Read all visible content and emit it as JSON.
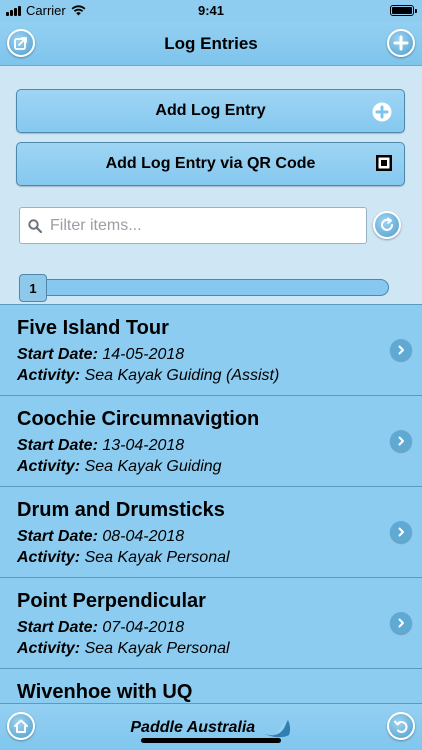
{
  "status_bar": {
    "carrier": "Carrier",
    "time": "9:41"
  },
  "nav": {
    "title": "Log Entries",
    "left_icon": "share-icon",
    "right_icon": "plus-icon"
  },
  "actions": {
    "add_entry": {
      "label": "Add Log Entry",
      "icon": "plus-circle-icon"
    },
    "add_qr": {
      "label": "Add Log Entry via QR Code",
      "icon": "qr-icon"
    }
  },
  "search": {
    "placeholder": "Filter items...",
    "value": ""
  },
  "pager": {
    "current_page": "1"
  },
  "list": {
    "items": [
      {
        "title": "Five Island Tour",
        "date_label": "Start Date:",
        "date": "14-05-2018",
        "activity_label": "Activity:",
        "activity": "Sea Kayak Guiding (Assist)"
      },
      {
        "title": "Coochie Circumnavigtion",
        "date_label": "Start Date:",
        "date": "13-04-2018",
        "activity_label": "Activity:",
        "activity": "Sea Kayak Guiding"
      },
      {
        "title": "Drum and Drumsticks",
        "date_label": "Start Date:",
        "date": "08-04-2018",
        "activity_label": "Activity:",
        "activity": "Sea Kayak Personal"
      },
      {
        "title": "Point Perpendicular",
        "date_label": "Start Date:",
        "date": "07-04-2018",
        "activity_label": "Activity:",
        "activity": "Sea Kayak Personal"
      },
      {
        "title": "Wivenhoe with UQ"
      }
    ]
  },
  "toolbar": {
    "brand": "Paddle Australia",
    "left_icon": "home-icon",
    "right_icon": "undo-icon"
  },
  "colors": {
    "accent": "#8cccf0",
    "background": "#cfe6f5",
    "border": "#4f88ad"
  }
}
